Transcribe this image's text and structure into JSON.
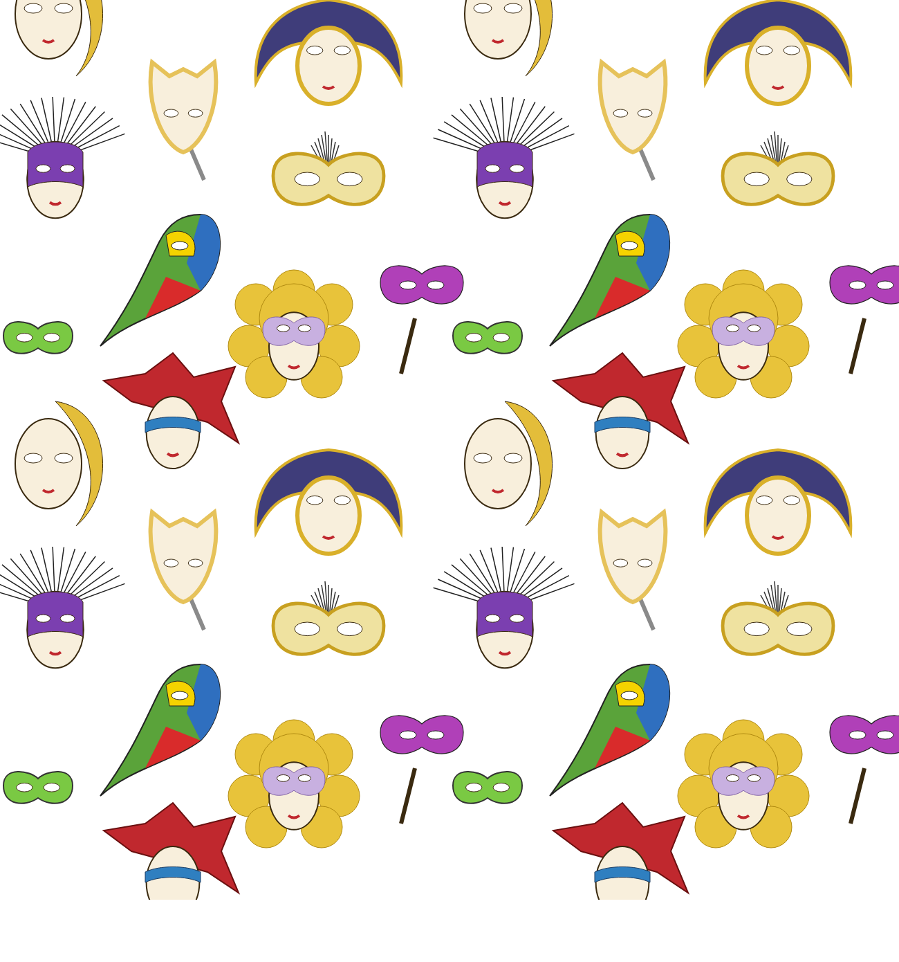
{
  "pattern": {
    "masks": [
      {
        "kind": "face",
        "color": "#e3bd3a"
      },
      {
        "kind": "stick",
        "color": "#e6c25a"
      },
      {
        "kind": "jester-hat",
        "color": "#3f3d7a"
      },
      {
        "kind": "feather",
        "color": "#7b3fb0"
      },
      {
        "kind": "eye-feather",
        "color": "#efe2a0"
      },
      {
        "kind": "beak",
        "color": "#5aa33a"
      },
      {
        "kind": "eye-stick",
        "color": "#b040b8"
      },
      {
        "kind": "eye",
        "color": "#7ac943"
      },
      {
        "kind": "sun",
        "color": "#e8c33a"
      },
      {
        "kind": "jester",
        "color": "#c0282e"
      }
    ]
  }
}
